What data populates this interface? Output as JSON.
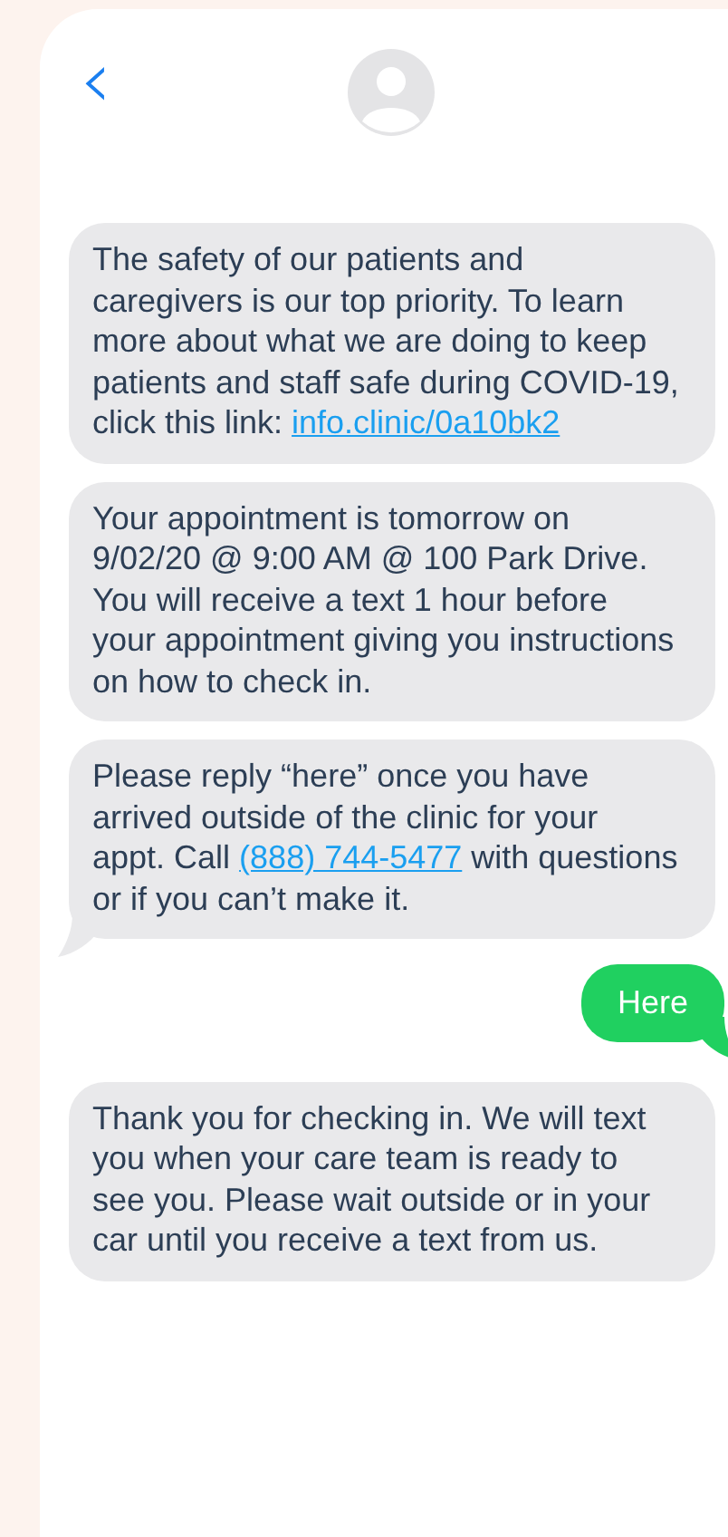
{
  "header": {
    "back": "‹"
  },
  "messages": [
    {
      "kind": "received",
      "tail": false,
      "parts": [
        {
          "kind": "text",
          "text": "The safety of our patients and caregivers is our top priority. To learn more about what we are doing to keep patients and staff safe during COVID-19, click this link: "
        },
        {
          "kind": "link",
          "text": "info.clinic/0a10bk2"
        }
      ]
    },
    {
      "kind": "received",
      "tail": false,
      "parts": [
        {
          "kind": "text",
          "text": "Your appointment is tomorrow on 9/02/20 @ 9:00 AM @ 100 Park Drive. You will receive a text 1 hour before your appointment giving you instructions on how to check in."
        }
      ]
    },
    {
      "kind": "received",
      "tail": true,
      "parts": [
        {
          "kind": "text",
          "text": "Please reply “here” once you have arrived outside of the clinic for your appt. Call "
        },
        {
          "kind": "link",
          "text": "(888) 744-5477"
        },
        {
          "kind": "text",
          "text": " with questions or if you can’t make it."
        }
      ]
    },
    {
      "kind": "sent",
      "tail": true,
      "parts": [
        {
          "kind": "text",
          "text": "Here"
        }
      ]
    },
    {
      "kind": "received",
      "tail": false,
      "parts": [
        {
          "kind": "text",
          "text": "Thank you for checking in. We will text you when your care team is ready to see you. Please wait outside or in your car until you receive a text from us."
        }
      ]
    }
  ]
}
